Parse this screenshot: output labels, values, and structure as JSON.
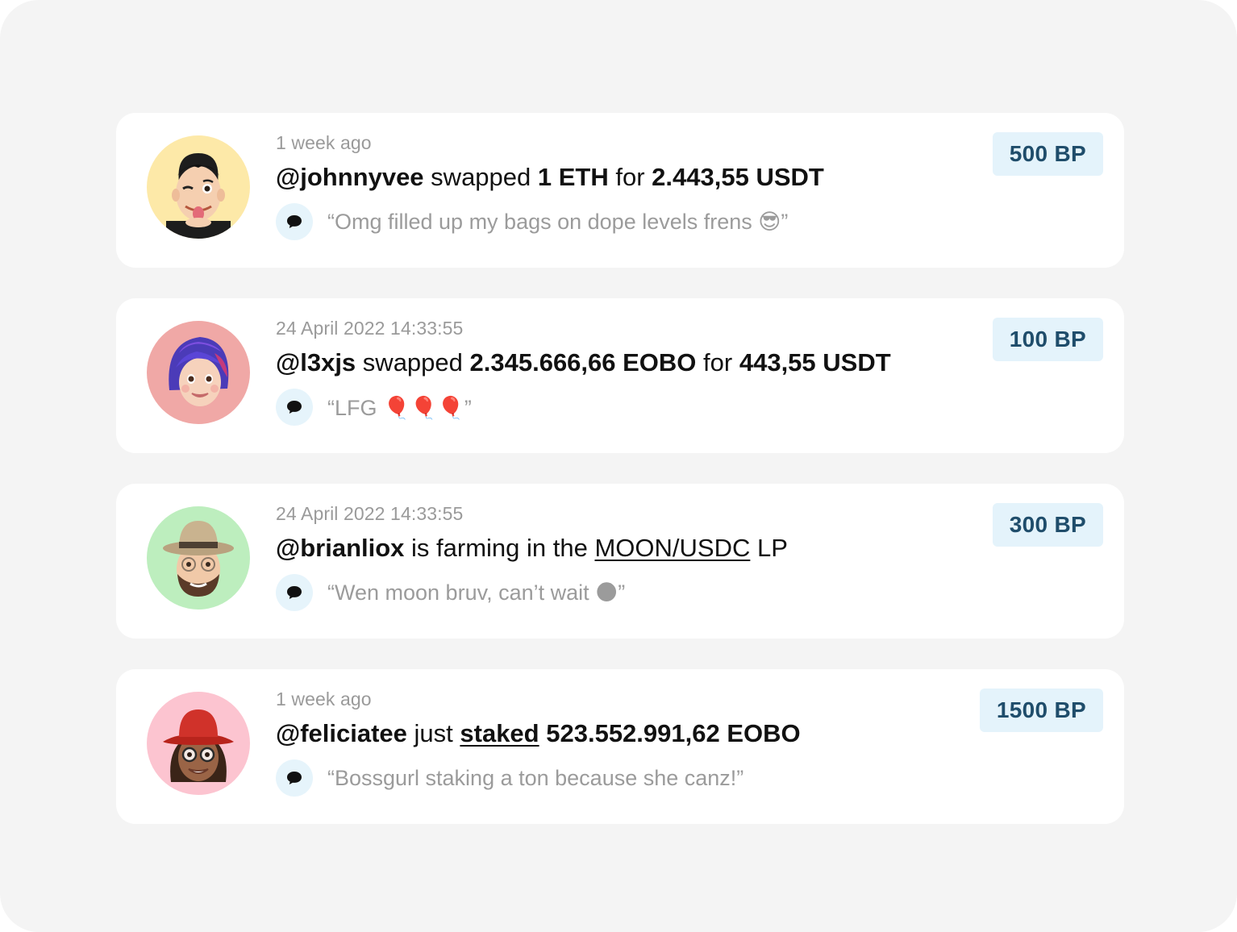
{
  "feed": [
    {
      "timestamp": "1 week ago",
      "user": "@johnnyvee",
      "parts": [
        {
          "text": " swapped ",
          "bold": false,
          "underline": false
        },
        {
          "text": "1 ETH",
          "bold": true,
          "underline": false
        },
        {
          "text": " for ",
          "bold": false,
          "underline": false
        },
        {
          "text": "2.443,55 USDT",
          "bold": true,
          "underline": false
        }
      ],
      "comment": "“Omg filled up my bags on dope levels frens 😎”",
      "points": "500 BP",
      "avatar_icon": "memoji-winking-boy-icon",
      "avatar_bg": "#fde9a8"
    },
    {
      "timestamp": "24 April 2022 14:33:55",
      "user": "@l3xjs",
      "parts": [
        {
          "text": " swapped ",
          "bold": false,
          "underline": false
        },
        {
          "text": "2.345.666,66 EOBO",
          "bold": true,
          "underline": false
        },
        {
          "text": " for ",
          "bold": false,
          "underline": false
        },
        {
          "text": "443,55 USDT",
          "bold": true,
          "underline": false
        }
      ],
      "comment": "“LFG 🎈🎈🎈”",
      "points": "100 BP",
      "avatar_icon": "memoji-blue-hair-girl-icon",
      "avatar_bg": "#f0a8a6"
    },
    {
      "timestamp": "24 April 2022 14:33:55",
      "user": "@brianliox",
      "parts": [
        {
          "text": " is farming in the ",
          "bold": false,
          "underline": false
        },
        {
          "text": "MOON/USDC",
          "bold": false,
          "underline": true
        },
        {
          "text": " LP",
          "bold": false,
          "underline": false
        }
      ],
      "comment": "“Wen moon bruv, can’t wait 🌑”",
      "points": "300 BP",
      "avatar_icon": "memoji-hat-beard-man-icon",
      "avatar_bg": "#bdeebe"
    },
    {
      "timestamp": "1 week ago",
      "user": "@feliciatee",
      "parts": [
        {
          "text": " just ",
          "bold": false,
          "underline": false
        },
        {
          "text": "staked",
          "bold": true,
          "underline": true
        },
        {
          "text": " 523.552.991,62 EOBO",
          "bold": true,
          "underline": false
        }
      ],
      "comment": "“Bossgurl staking a ton because she canz!”",
      "points": "1500 BP",
      "avatar_icon": "memoji-red-hat-woman-icon",
      "avatar_bg": "#fcc4d0"
    }
  ],
  "icons": {
    "comment": "speech-bubble-icon"
  },
  "colors": {
    "badge_bg": "#e4f3fb",
    "badge_text": "#1f4d6b",
    "muted_text": "#9b9b9b",
    "page_bg": "#f4f4f4"
  }
}
